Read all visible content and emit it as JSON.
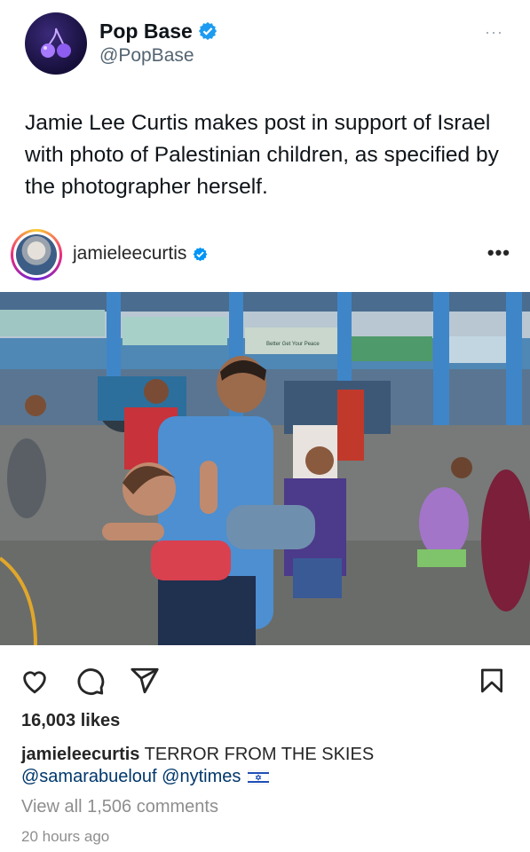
{
  "tweet": {
    "display_name": "Pop Base",
    "handle": "@PopBase",
    "more_label": "···",
    "text": "Jamie Lee Curtis makes post in support of Israel with photo of Palestinian children, as specified by the photographer herself."
  },
  "instagram": {
    "username": "jamieleecurtis",
    "more_label": "•••",
    "likes": "16,003 likes",
    "caption_user": "jamieleecurtis",
    "caption_text": " TERROR FROM THE SKIES",
    "mention_1": "@samarabuelouf",
    "mention_2": "@nytimes",
    "view_all": "View all 1,506 comments",
    "time": "20 hours ago",
    "photo_signs": [
      "Better Get Your Peace"
    ]
  },
  "colors": {
    "verified_blue": "#1d9bf0",
    "ig_blue": "#0095f6",
    "link": "#00376b",
    "muted": "#8e8e8e"
  }
}
